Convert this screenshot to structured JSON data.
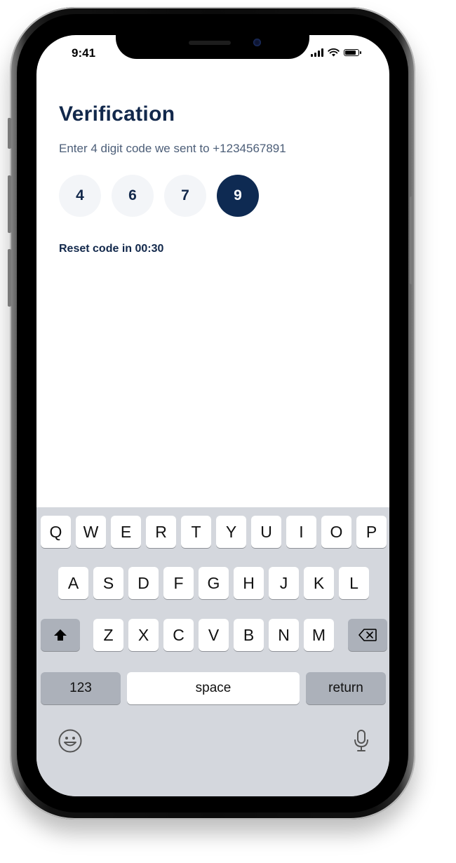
{
  "status_bar": {
    "time": "9:41"
  },
  "screen": {
    "title": "Verification",
    "subtitle": "Enter 4 digit code we sent to +1234567891",
    "code_digits": [
      "4",
      "6",
      "7",
      "9"
    ],
    "active_digit_index": 3,
    "reset_text": "Reset code in 00:30"
  },
  "colors": {
    "primary": "#12284b",
    "active_digit_bg": "#0e2a52",
    "digit_bg": "#f3f5f8",
    "keyboard_bg": "#d4d7dd"
  },
  "keyboard": {
    "row1": [
      "Q",
      "W",
      "E",
      "R",
      "T",
      "Y",
      "U",
      "I",
      "O",
      "P"
    ],
    "row2": [
      "A",
      "S",
      "D",
      "F",
      "G",
      "H",
      "J",
      "K",
      "L"
    ],
    "row3": [
      "Z",
      "X",
      "C",
      "V",
      "B",
      "N",
      "M"
    ],
    "numbers_label": "123",
    "space_label": "space",
    "return_label": "return",
    "icons": {
      "shift": "shift-icon",
      "backspace": "backspace-icon",
      "emoji": "emoji-icon",
      "microphone": "microphone-icon"
    }
  }
}
